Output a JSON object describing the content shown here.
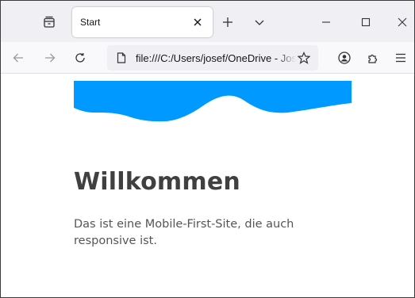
{
  "browser": {
    "tab": {
      "title": "Start"
    },
    "urlbar": {
      "url": "file:///C:/Users/josef/OneDrive - Josef Sch"
    }
  },
  "page": {
    "heading": "Willkommen",
    "paragraph": "Das ist eine Mobile-First-Site, die auch responsive ist.",
    "wave_color": "#0099ff"
  },
  "icons": [
    "tab-list-icon",
    "close-tab-icon",
    "new-tab-icon",
    "list-all-tabs-icon",
    "minimize-icon",
    "maximize-icon",
    "close-window-icon",
    "back-icon",
    "forward-icon",
    "reload-icon",
    "page-icon",
    "bookmark-star-icon",
    "account-icon",
    "extensions-icon",
    "menu-icon"
  ]
}
